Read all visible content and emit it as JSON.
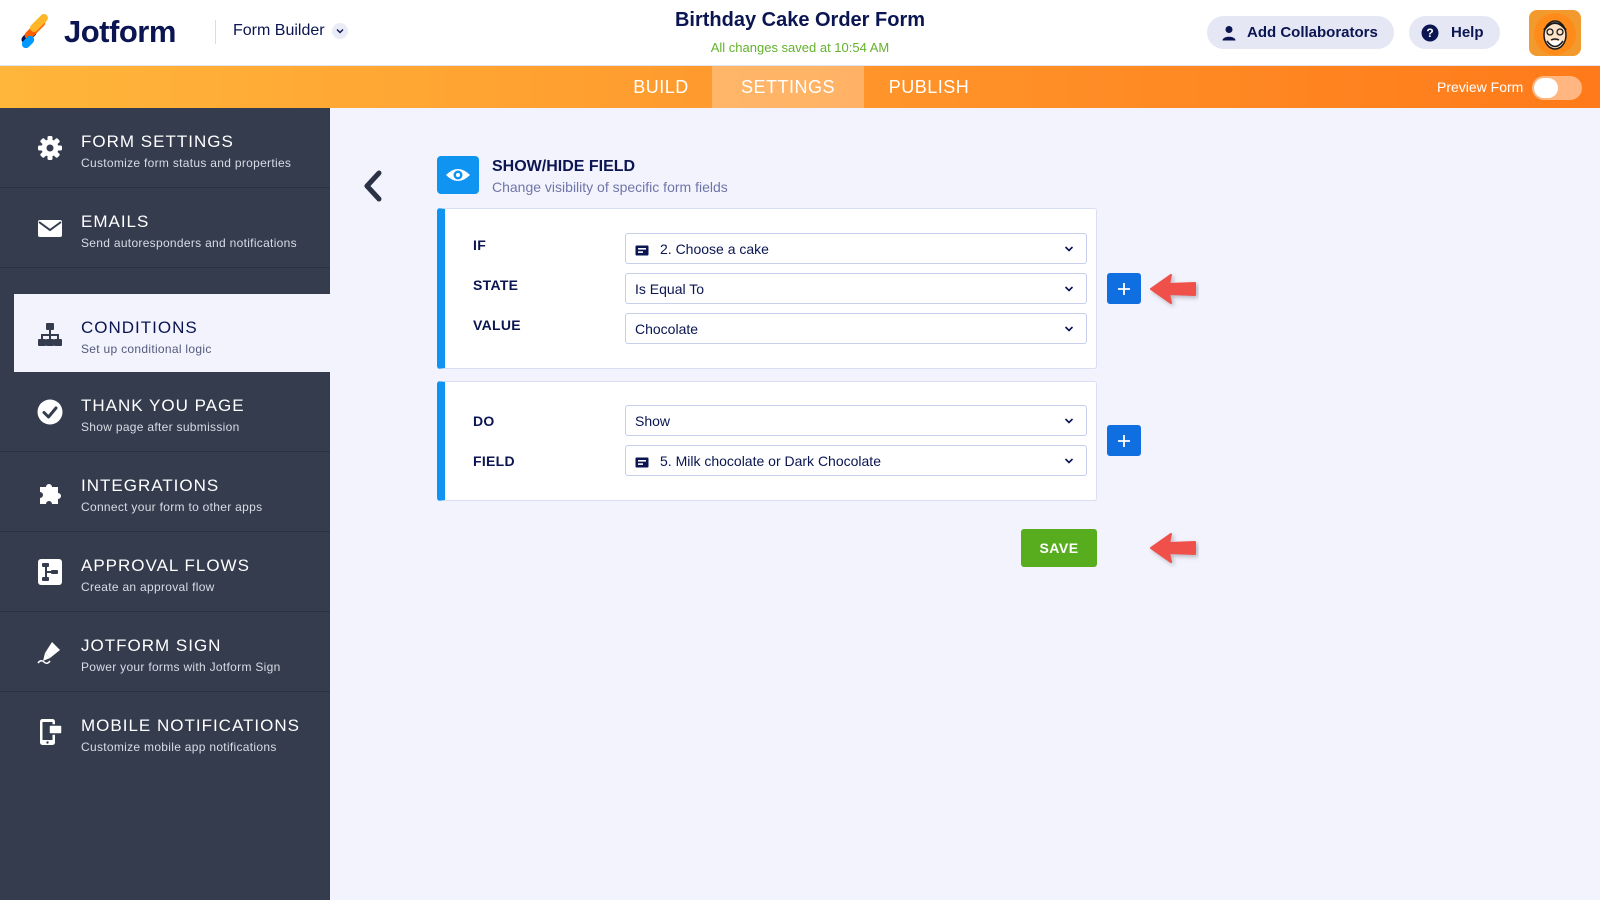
{
  "header": {
    "logo_text": "Jotform",
    "builder_label": "Form Builder",
    "form_title": "Birthday Cake Order Form",
    "save_status": "All changes saved at 10:54 AM",
    "collaborators_label": "Add Collaborators",
    "help_label": "Help"
  },
  "nav": {
    "tabs": [
      {
        "label": "BUILD"
      },
      {
        "label": "SETTINGS",
        "active": true
      },
      {
        "label": "PUBLISH"
      }
    ],
    "preview_label": "Preview Form",
    "preview_enabled": false
  },
  "sidebar": {
    "items": [
      {
        "title": "FORM SETTINGS",
        "subtitle": "Customize form status and properties",
        "icon": "gear-icon"
      },
      {
        "title": "EMAILS",
        "subtitle": "Send autoresponders and notifications",
        "icon": "envelope-icon"
      },
      {
        "title": "CONDITIONS",
        "subtitle": "Set up conditional logic",
        "icon": "sitemap-icon",
        "active": true
      },
      {
        "title": "THANK YOU PAGE",
        "subtitle": "Show page after submission",
        "icon": "check-circle-icon"
      },
      {
        "title": "INTEGRATIONS",
        "subtitle": "Connect your form to other apps",
        "icon": "puzzle-icon"
      },
      {
        "title": "APPROVAL FLOWS",
        "subtitle": "Create an approval flow",
        "icon": "flow-icon"
      },
      {
        "title": "JOTFORM SIGN",
        "subtitle": "Power your forms with Jotform Sign",
        "icon": "pen-icon"
      },
      {
        "title": "MOBILE NOTIFICATIONS",
        "subtitle": "Customize mobile app notifications",
        "icon": "mobile-icon"
      }
    ]
  },
  "condition": {
    "title": "SHOW/HIDE FIELD",
    "subtitle": "Change visibility of specific form fields",
    "if_label": "IF",
    "if_value": "2. Choose a cake",
    "state_label": "STATE",
    "state_value": "Is Equal To",
    "value_label": "VALUE",
    "value_value": "Chocolate",
    "do_label": "DO",
    "do_value": "Show",
    "field_label": "FIELD",
    "field_value": "5. Milk chocolate or Dark Chocolate",
    "save_label": "SAVE"
  },
  "colors": {
    "accent_blue": "#0f94f1",
    "plus_blue": "#0f6fe0",
    "save_green": "#58ad1e",
    "sidebar_bg": "#343c4d",
    "arrow_red": "#f0504a"
  }
}
